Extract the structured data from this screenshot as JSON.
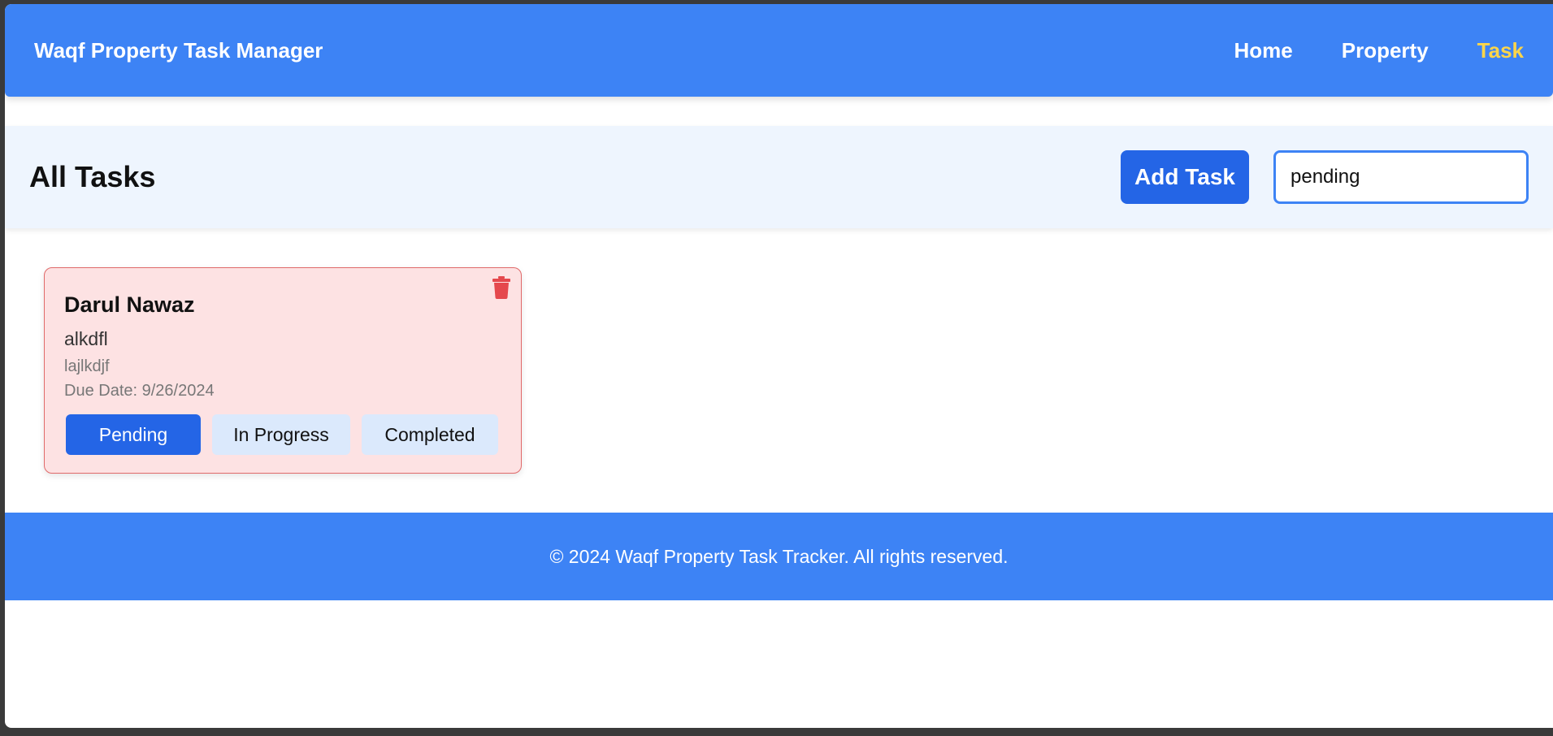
{
  "navbar": {
    "brand": "Waqf Property Task Manager",
    "links": [
      {
        "label": "Home",
        "active": false
      },
      {
        "label": "Property",
        "active": false
      },
      {
        "label": "Task",
        "active": true
      }
    ]
  },
  "toolbar": {
    "title": "All Tasks",
    "add_label": "Add Task",
    "search_value": "pending"
  },
  "tasks": [
    {
      "title": "Darul Nawaz",
      "description": "alkdfl",
      "subtitle": "lajlkdjf",
      "due": "Due Date: 9/26/2024",
      "statuses": [
        "Pending",
        "In Progress",
        "Completed"
      ],
      "current_status": "Pending"
    }
  ],
  "footer": {
    "text": "© 2024 Waqf Property Task Tracker. All rights reserved."
  },
  "colors": {
    "primary": "#3d83f5",
    "button": "#2465e6",
    "active_nav": "#fcd54a",
    "card_bg": "#fde2e3",
    "delete": "#e5484d"
  },
  "icons": {
    "delete": "trash-icon"
  }
}
